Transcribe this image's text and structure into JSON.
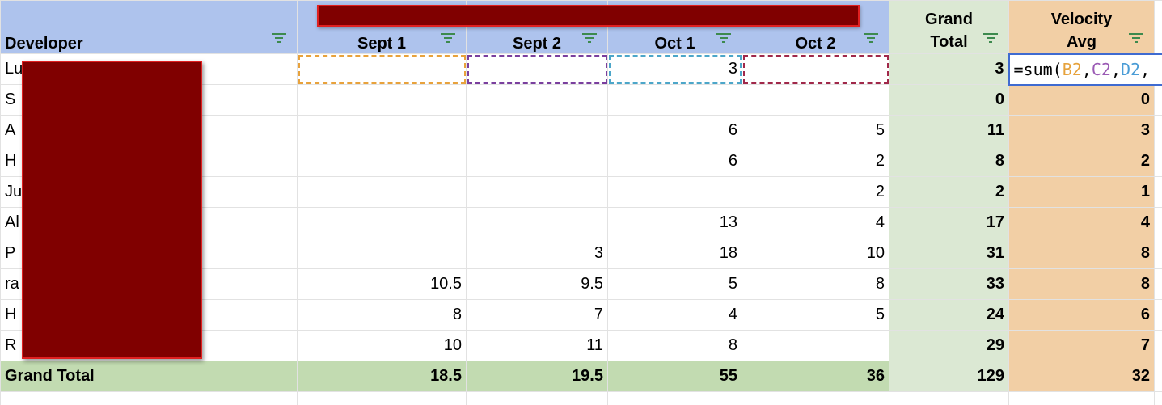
{
  "header": {
    "developer": "Developer",
    "sprints": [
      "Sept 1",
      "Sept 2",
      "Oct 1",
      "Oct 2"
    ],
    "grand_total_line1": "Grand",
    "grand_total_line2": "Total",
    "velocity_line1": "Velocity",
    "velocity_line2": "Avg"
  },
  "rows": [
    {
      "name": "Lu",
      "sept1": "",
      "sept2": "",
      "oct1": "3",
      "oct2": "",
      "grand_total": "3",
      "velocity": ""
    },
    {
      "name": "S",
      "sept1": "",
      "sept2": "",
      "oct1": "",
      "oct2": "",
      "grand_total": "0",
      "velocity": "0"
    },
    {
      "name": "A",
      "sept1": "",
      "sept2": "",
      "oct1": "6",
      "oct2": "5",
      "grand_total": "11",
      "velocity": "3"
    },
    {
      "name": "H",
      "sept1": "",
      "sept2": "",
      "oct1": "6",
      "oct2": "2",
      "grand_total": "8",
      "velocity": "2"
    },
    {
      "name": "Ju",
      "sept1": "",
      "sept2": "",
      "oct1": "",
      "oct2": "2",
      "grand_total": "2",
      "velocity": "1"
    },
    {
      "name": "Al",
      "sept1": "",
      "sept2": "",
      "oct1": "13",
      "oct2": "4",
      "grand_total": "17",
      "velocity": "4"
    },
    {
      "name": "P",
      "sept1": "",
      "sept2": "3",
      "oct1": "18",
      "oct2": "10",
      "grand_total": "31",
      "velocity": "8"
    },
    {
      "name": "ra",
      "sept1": "10.5",
      "sept2": "9.5",
      "oct1": "5",
      "oct2": "8",
      "grand_total": "33",
      "velocity": "8"
    },
    {
      "name": "H",
      "sept1": "8",
      "sept2": "7",
      "oct1": "4",
      "oct2": "5",
      "grand_total": "24",
      "velocity": "6"
    },
    {
      "name": "R",
      "sept1": "10",
      "sept2": "11",
      "oct1": "8",
      "oct2": "",
      "grand_total": "29",
      "velocity": "7"
    }
  ],
  "total": {
    "label": "Grand Total",
    "sept1": "18.5",
    "sept2": "19.5",
    "oct1": "55",
    "oct2": "36",
    "grand_total": "129",
    "velocity": "32"
  },
  "formula": {
    "prefix": "=sum(",
    "ref_b": "B2",
    "sep1": ",",
    "ref_c": "C2",
    "sep2": ",",
    "ref_d": "D2",
    "sep3": ","
  },
  "colors": {
    "header_blue": "#aec3ed",
    "grand_total_green": "#dbe8d3",
    "velocity_orange": "#f2cfa5",
    "total_row_green": "#c2dbb1",
    "redaction": "#800000",
    "filter_icon": "#3d8a4e"
  }
}
